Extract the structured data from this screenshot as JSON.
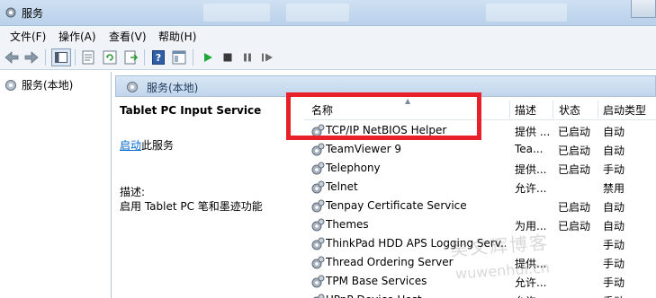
{
  "window": {
    "title": "服务"
  },
  "menu": [
    "文件(F)",
    "操作(A)",
    "查看(V)",
    "帮助(H)"
  ],
  "tree": {
    "root_label": "服务(本地)"
  },
  "panel": {
    "title": "服务(本地)"
  },
  "detail": {
    "service_name": "Tablet PC Input Service",
    "start_link": "启动",
    "start_suffix": "此服务",
    "desc_label": "描述:",
    "desc_text": "启用 Tablet PC 笔和墨迹功能"
  },
  "columns": {
    "name": "名称",
    "desc": "描述",
    "status": "状态",
    "start_type": "启动类型"
  },
  "rows": [
    {
      "name": "TCP/IP NetBIOS Helper",
      "desc": "提供 ...",
      "status": "已启动",
      "start_type": "自动"
    },
    {
      "name": "TeamViewer 9",
      "desc": "Tea...",
      "status": "已启动",
      "start_type": "自动"
    },
    {
      "name": "Telephony",
      "desc": "提供...",
      "status": "已启动",
      "start_type": "手动"
    },
    {
      "name": "Telnet",
      "desc": "允许...",
      "status": "",
      "start_type": "禁用"
    },
    {
      "name": "Tenpay Certificate Service",
      "desc": "",
      "status": "已启动",
      "start_type": "自动"
    },
    {
      "name": "Themes",
      "desc": "为用...",
      "status": "已启动",
      "start_type": "自动"
    },
    {
      "name": "ThinkPad HDD APS Logging Serv...",
      "desc": "",
      "status": "",
      "start_type": "手动"
    },
    {
      "name": "Thread Ordering Server",
      "desc": "提供...",
      "status": "",
      "start_type": "手动"
    },
    {
      "name": "TPM Base Services",
      "desc": "允许...",
      "status": "",
      "start_type": "手动"
    },
    {
      "name": "UPnP Device Host",
      "desc": "允许...",
      "status": "",
      "start_type": "手动"
    }
  ],
  "watermark": {
    "line1": "吴文辉博客",
    "line2": "wuwenhui.cn"
  },
  "colors": {
    "annotation": "#e8202a",
    "link": "#0066cc",
    "header_bg": "#c2d6ec"
  }
}
